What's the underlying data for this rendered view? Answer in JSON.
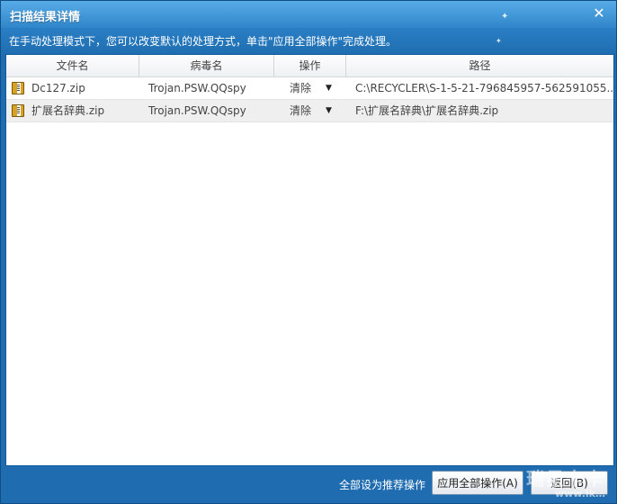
{
  "window": {
    "title": "扫描结果详情",
    "close_glyph": "✕",
    "hint": "在手动处理模式下，您可以改变默认的处理方式，单击\"应用全部操作\"完成处理。"
  },
  "table": {
    "headers": [
      "文件名",
      "病毒名",
      "操作",
      "路径"
    ],
    "rows": [
      {
        "icon": "zip-archive-icon",
        "name": "Dc127.zip",
        "virus": "Trojan.PSW.QQspy",
        "operation": "清除",
        "path": "C:\\RECYCLER\\S-1-5-21-796845957-562591055..."
      },
      {
        "icon": "zip-archive-icon",
        "name": "扩展名辞典.zip",
        "virus": "Trojan.PSW.QQspy",
        "operation": "清除",
        "path": "F:\\扩展名辞典\\扩展名辞典.zip"
      }
    ]
  },
  "footer": {
    "recommend_link": "全部设为推荐操作",
    "apply_button": "应用全部操作(A)",
    "back_button": "返回(B)"
  },
  "watermark": {
    "text": "瑞星卡卡",
    "url": "www.ik…"
  },
  "colors": {
    "window_blue": "#1f6db0",
    "title_blue": "#3b95d6",
    "row_alt": "#efefef"
  }
}
